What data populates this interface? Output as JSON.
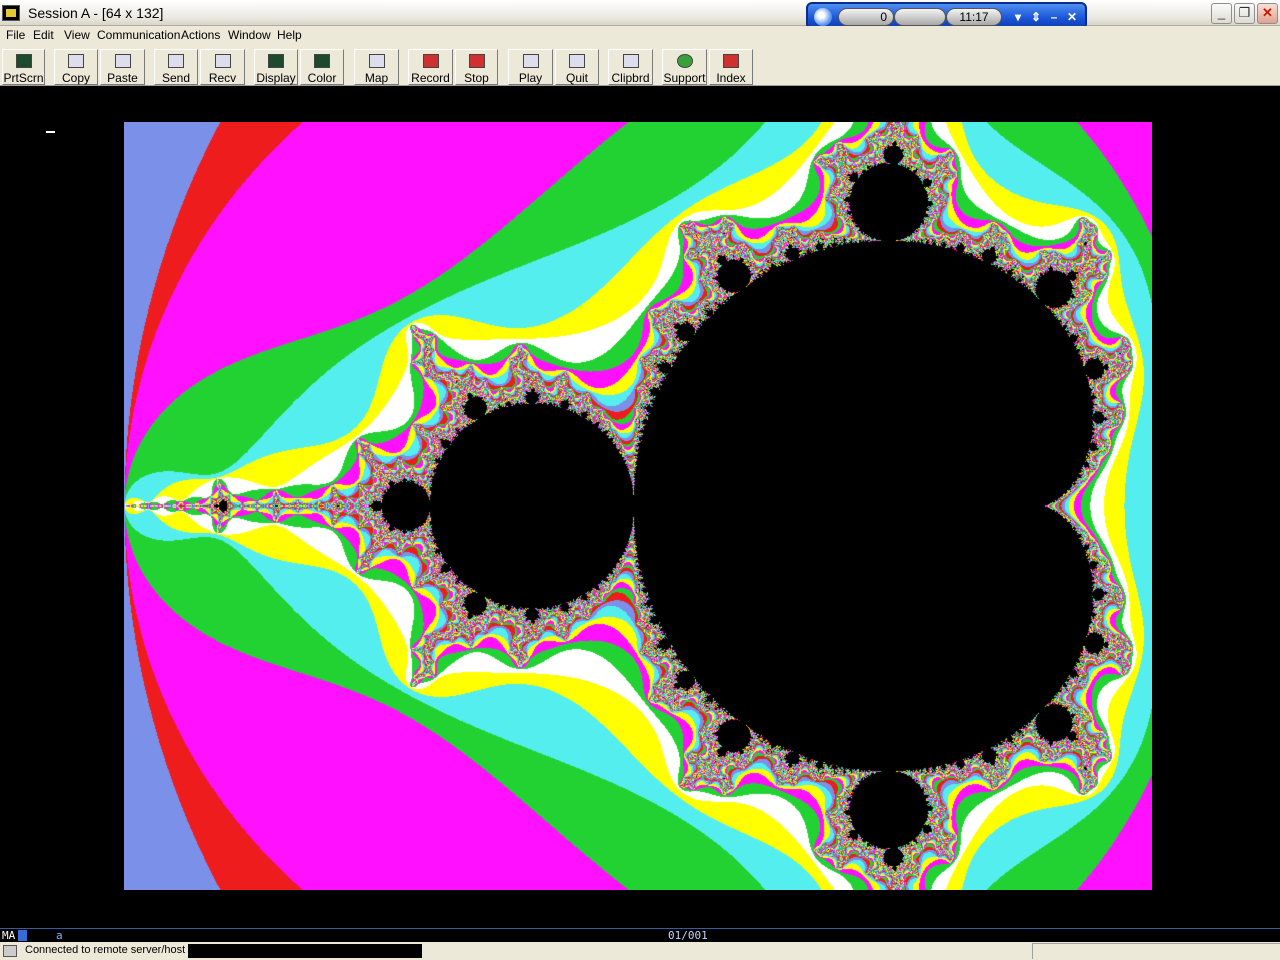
{
  "window": {
    "title": "Session A - [64 x 132]"
  },
  "att_toolbar": {
    "counter": "0",
    "time": "11:17"
  },
  "menu": {
    "items": [
      "File",
      "Edit",
      "View",
      "Communication",
      "Actions",
      "Window",
      "Help"
    ]
  },
  "toolbar": {
    "buttons": [
      "PrtScrn",
      "Copy",
      "Paste",
      "Send",
      "Recv",
      "Display",
      "Color",
      "Map",
      "Record",
      "Stop",
      "Play",
      "Quit",
      "Clipbrd",
      "Support",
      "Index"
    ]
  },
  "terminal": {
    "content": "Mandelbrot set fractal",
    "palette": {
      "interior": "#000000",
      "band1": "#7b90e8",
      "band2": "#ee1c1c",
      "band3": "#ff10ff",
      "band4": "#22d233",
      "band5": "#55eeee",
      "band6": "#ffff00",
      "band7": "#ffffff"
    }
  },
  "oia": {
    "mode": "MA",
    "indicator": "a",
    "position": "01/001"
  },
  "status": {
    "text": "Connected to remote server/host"
  }
}
